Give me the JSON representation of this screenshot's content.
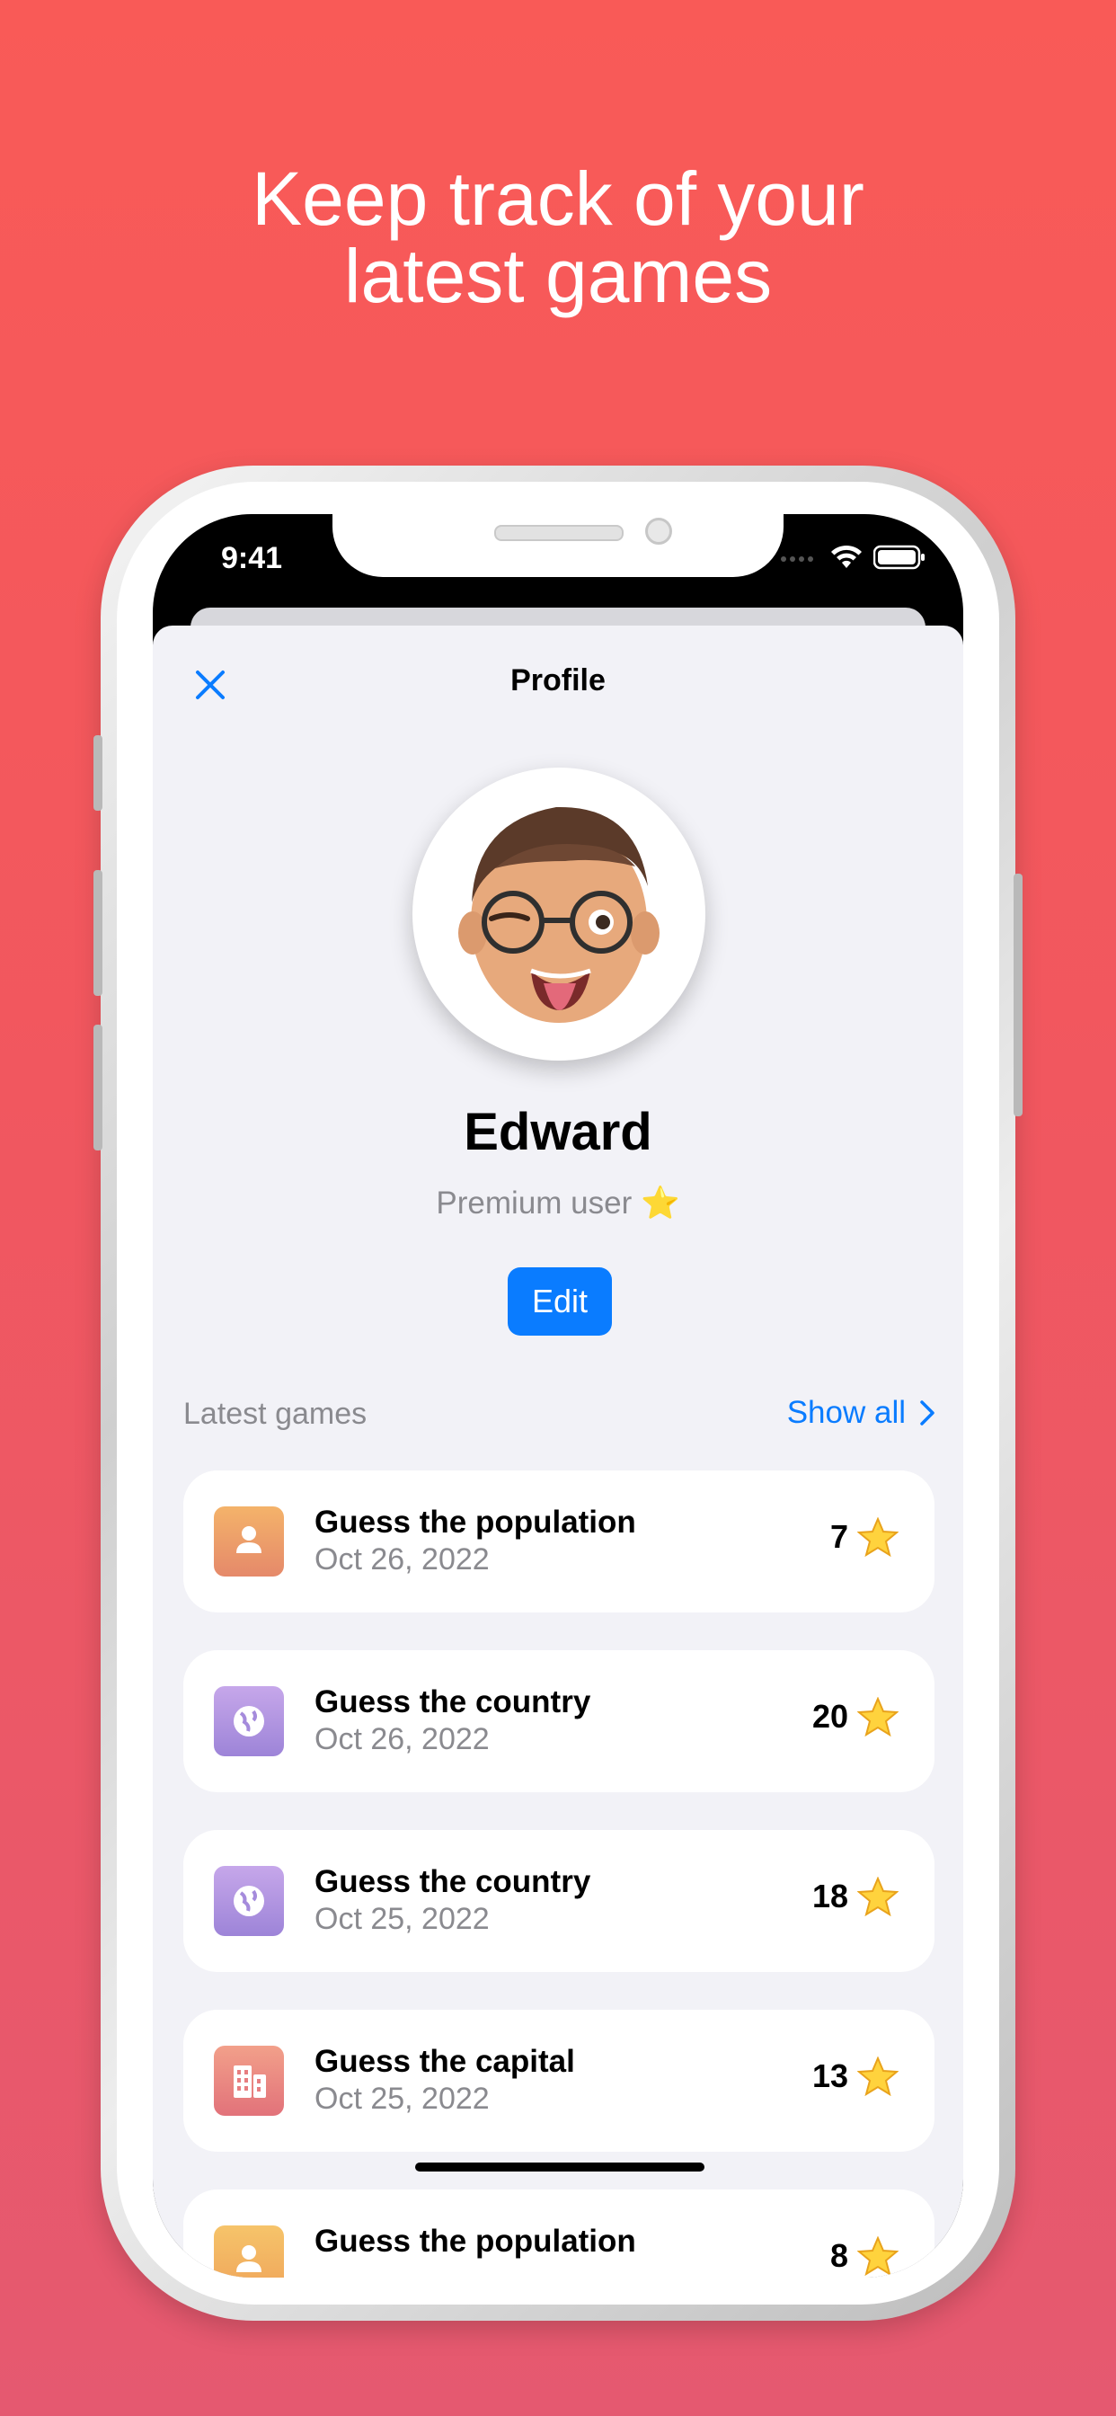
{
  "headline": {
    "line1": "Keep track of your",
    "line2": "latest games"
  },
  "status_bar": {
    "time": "9:41"
  },
  "nav": {
    "title": "Profile"
  },
  "profile": {
    "name": "Edward",
    "tier": "Premium user ⭐",
    "edit_label": "Edit"
  },
  "latest": {
    "label": "Latest games",
    "show_all": "Show all"
  },
  "games": [
    {
      "title": "Guess the population",
      "date": "Oct 26, 2022",
      "score": "7",
      "icon": "person-icon",
      "color_a": "#F4B36A",
      "color_b": "#E5896A"
    },
    {
      "title": "Guess the country",
      "date": "Oct 26, 2022",
      "score": "20",
      "icon": "globe-icon",
      "color_a": "#C6A7EA",
      "color_b": "#9D84D8"
    },
    {
      "title": "Guess the country",
      "date": "Oct 25, 2022",
      "score": "18",
      "icon": "globe-icon",
      "color_a": "#C6A7EA",
      "color_b": "#9D84D8"
    },
    {
      "title": "Guess the capital",
      "date": "Oct 25, 2022",
      "score": "13",
      "icon": "building-icon",
      "color_a": "#F2A08A",
      "color_b": "#E2727A"
    },
    {
      "title": "Guess the population",
      "date": "",
      "score": "8",
      "icon": "person-icon",
      "color_a": "#F6C46A",
      "color_b": "#EFA45A"
    }
  ],
  "colors": {
    "accent": "#0A7CFF",
    "background_top": "#F95A57",
    "background_bottom": "#E55970",
    "sheet": "#F2F2F7"
  }
}
